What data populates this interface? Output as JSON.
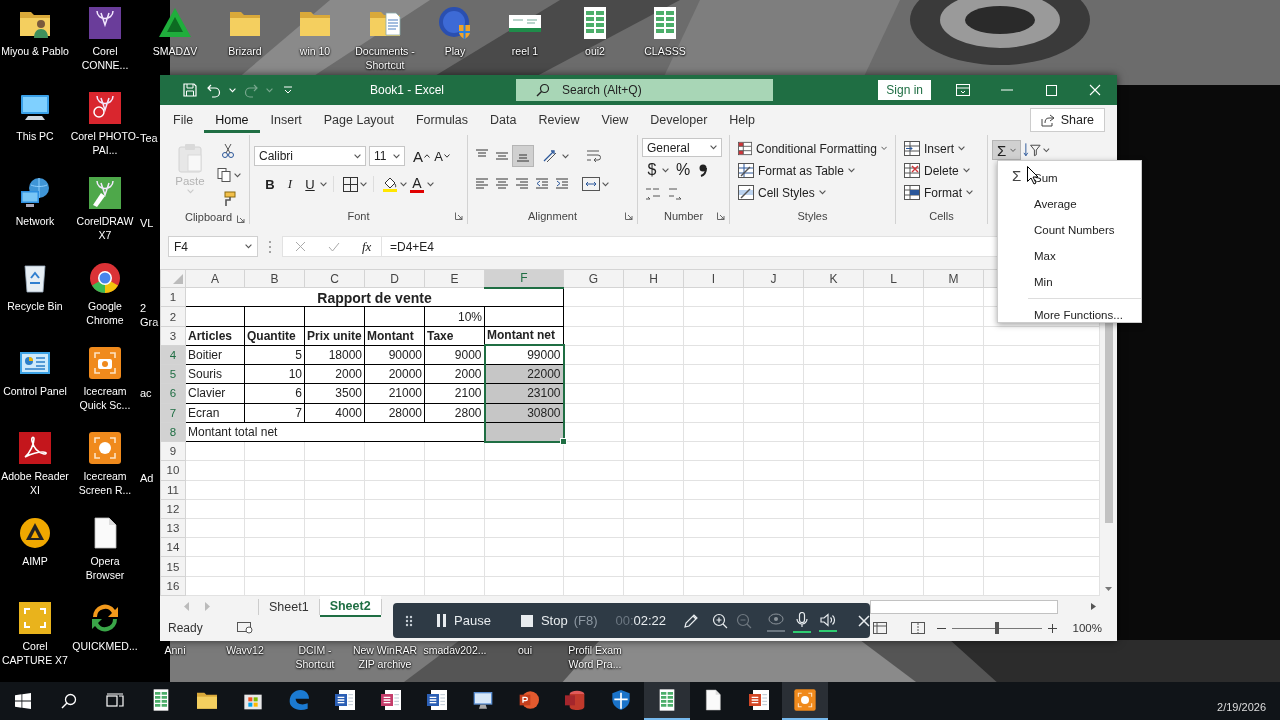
{
  "desktop": {
    "columns": [
      [
        {
          "label": "Miyou & Pablo"
        },
        {
          "label": "This PC"
        },
        {
          "label": "Network"
        },
        {
          "label": "Recycle Bin"
        },
        {
          "label": "Control Panel"
        },
        {
          "label": "Adobe Reader XI"
        },
        {
          "label": "AIMP"
        },
        {
          "label": "Corel CAPTURE X7"
        }
      ],
      [
        {
          "label": "Corel CONNE..."
        },
        {
          "label": "Corel PHOTO-PAI..."
        },
        {
          "label": "CorelDRAW X7"
        },
        {
          "label": "Google Chrome"
        },
        {
          "label": "Icecream Quick Sc..."
        },
        {
          "label": "Icecream Screen R..."
        },
        {
          "label": "Opera Browser"
        },
        {
          "label": "QUICKMED..."
        }
      ]
    ],
    "top_row": [
      {
        "label": "SMADΔV"
      },
      {
        "label": "Brizard"
      },
      {
        "label": "win 10"
      },
      {
        "label": "Documents - Shortcut"
      },
      {
        "label": "Play"
      },
      {
        "label": "reel 1"
      },
      {
        "label": "oui2"
      },
      {
        "label": "CLASSS"
      }
    ],
    "cut_labels": [
      "Tea",
      "VL",
      "2 Gra",
      "ac",
      "Ad"
    ],
    "bottom_labels": [
      "Anni",
      "Wavv12",
      "DCIM - Shortcut",
      "New WinRAR ZIP archive",
      "smadav202...",
      "oui",
      "Profil Exam Word Pra..."
    ]
  },
  "excel": {
    "title_bar": {
      "title": "Book1 - Excel",
      "search_placeholder": "Search (Alt+Q)",
      "sign_in": "Sign in",
      "redo": {
        "disabled": true
      }
    },
    "tabs": [
      {
        "label": "File",
        "selected": false
      },
      {
        "label": "Home",
        "selected": true
      },
      {
        "label": "Insert",
        "selected": false
      },
      {
        "label": "Page Layout",
        "selected": false
      },
      {
        "label": "Formulas",
        "selected": false
      },
      {
        "label": "Data",
        "selected": false
      },
      {
        "label": "Review",
        "selected": false
      },
      {
        "label": "View",
        "selected": false
      },
      {
        "label": "Developer",
        "selected": false
      },
      {
        "label": "Help",
        "selected": false
      }
    ],
    "share": "Share",
    "ribbon": {
      "clipboard": {
        "label": "Clipboard",
        "paste": {
          "label": "Paste",
          "disabled": true
        }
      },
      "font": {
        "label": "Font",
        "name": "Calibri",
        "size": "11",
        "grow": "A",
        "shrink": "A",
        "bold": "B",
        "italic": "I",
        "underline": "U",
        "text_color_button": "A"
      },
      "alignment": {
        "label": "Alignment",
        "vertical": [
          {
            "selected": false
          },
          {
            "selected": false
          },
          {
            "selected": true
          }
        ]
      },
      "number": {
        "label": "Number",
        "format": "General",
        "currency": "$",
        "percent": "%"
      },
      "styles": {
        "label": "Styles",
        "buttons": [
          "Conditional Formatting",
          "Format as Table",
          "Cell Styles"
        ]
      },
      "cells": {
        "label": "Cells",
        "buttons": [
          "Insert",
          "Delete",
          "Format"
        ]
      },
      "editing": {
        "autosum": {
          "label": "Σ",
          "pressed": true
        }
      }
    },
    "formula_bar": {
      "name_box": "F4",
      "fx": "fx",
      "formula": "=D4+E4"
    },
    "sheet": {
      "columns": [
        "A",
        "B",
        "C",
        "D",
        "E",
        "F",
        "G",
        "H",
        "I",
        "J",
        "K",
        "L",
        "M"
      ],
      "rows": [
        {
          "number": "1",
          "kind": "title",
          "title": "Rapport de vente"
        },
        {
          "number": "2",
          "kind": "rate",
          "rate": "10%"
        },
        {
          "number": "3",
          "kind": "header",
          "cells": [
            "Articles",
            "Quantite",
            "Prix unite",
            "Montant",
            "Taxe",
            "Montant net"
          ]
        },
        {
          "number": "4",
          "kind": "data",
          "cells": [
            "Boitier",
            "5",
            "18000",
            "90000",
            "9000",
            "99000"
          ],
          "selected": true,
          "active": true
        },
        {
          "number": "5",
          "kind": "data",
          "cells": [
            "Souris",
            "10",
            "2000",
            "20000",
            "2000",
            "22000"
          ],
          "selected": true,
          "active": false
        },
        {
          "number": "6",
          "kind": "data",
          "cells": [
            "Clavier",
            "6",
            "3500",
            "21000",
            "2100",
            "23100"
          ],
          "selected": true,
          "active": false
        },
        {
          "number": "7",
          "kind": "data",
          "cells": [
            "Ecran",
            "7",
            "4000",
            "28000",
            "2800",
            "30800"
          ],
          "selected": true,
          "active": false
        },
        {
          "number": "8",
          "kind": "total",
          "label": "Montant total net",
          "selected": true,
          "active": false
        },
        {
          "number": "9",
          "kind": "empty"
        },
        {
          "number": "10",
          "kind": "empty"
        },
        {
          "number": "11",
          "kind": "empty"
        },
        {
          "number": "12",
          "kind": "empty"
        },
        {
          "number": "13",
          "kind": "empty"
        },
        {
          "number": "14",
          "kind": "empty"
        },
        {
          "number": "15",
          "kind": "empty"
        },
        {
          "number": "16",
          "kind": "empty"
        }
      ]
    },
    "sheet_tabs": [
      {
        "label": "Sheet1",
        "selected": false
      },
      {
        "label": "Sheet2",
        "selected": true
      }
    ],
    "status_bar": {
      "status": "Ready",
      "zoom": {
        "level": 0.5,
        "reading": "100%"
      }
    },
    "autosum_menu": {
      "sum_icon": "Σ",
      "items": [
        "Sum",
        "Average",
        "Count Numbers",
        "Max",
        "Min"
      ],
      "more": "More Functions..."
    }
  },
  "recorder": {
    "pause": "Pause",
    "stop": "Stop",
    "stop_key": "(F8)",
    "elapsed_dim": "00:",
    "elapsed": "02:22",
    "zoom_out": {
      "disabled": true
    },
    "webcam": {
      "on": false
    },
    "microphone": {
      "on": true
    },
    "speaker": {
      "on": true
    }
  },
  "taskbar": {
    "date": "2/19/2026",
    "apps": [
      {
        "active": false
      },
      {
        "active": false
      },
      {
        "active": false
      },
      {
        "active": false
      },
      {
        "active": false
      },
      {
        "active": false
      },
      {
        "active": false
      },
      {
        "active": false
      },
      {
        "active": false
      },
      {
        "active": false
      },
      {
        "active": false
      },
      {
        "active": true
      },
      {
        "active": false
      },
      {
        "active": false
      },
      {
        "active": true
      }
    ]
  }
}
